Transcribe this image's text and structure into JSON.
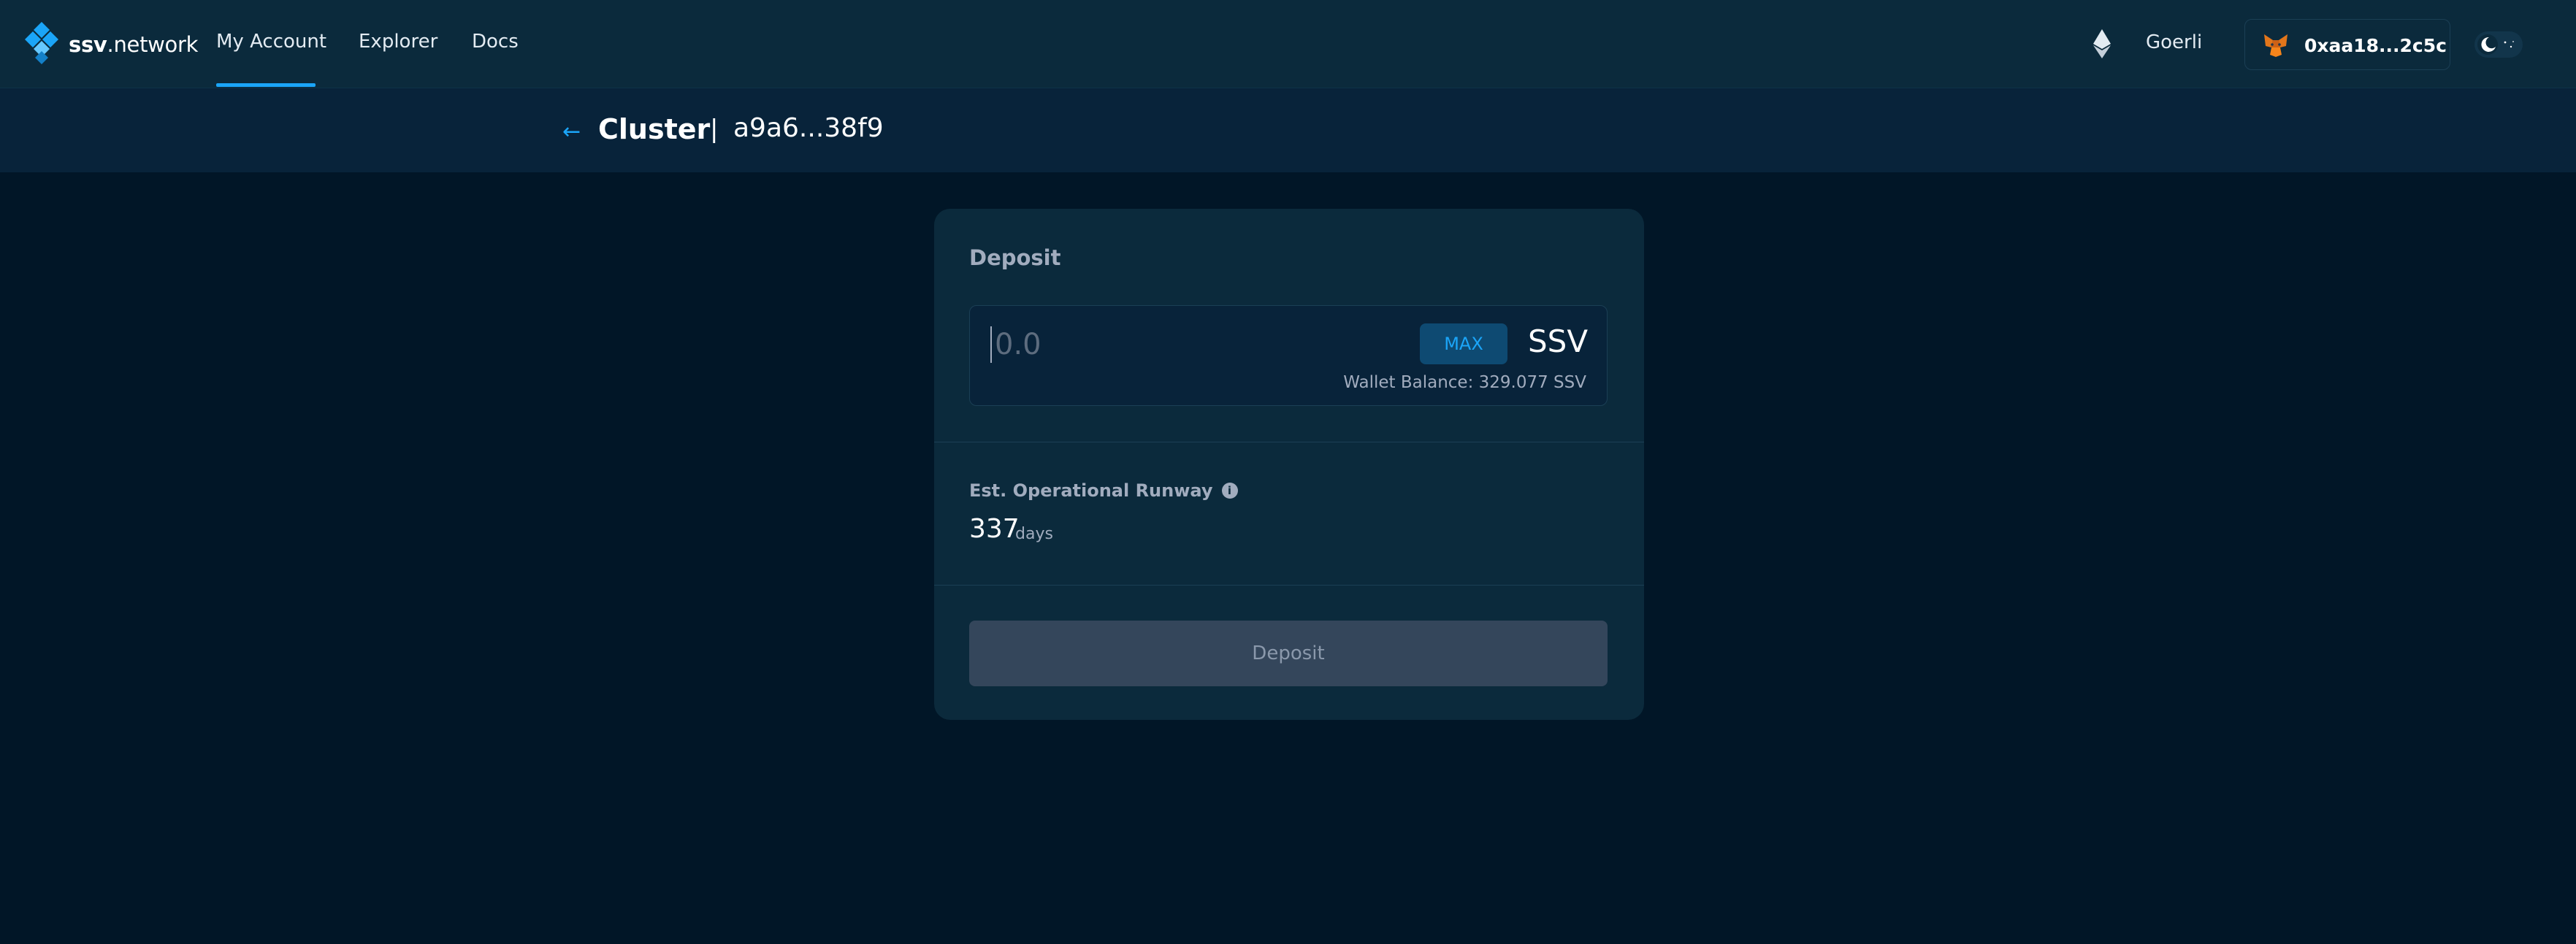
{
  "brand": {
    "name_bold": "ssv",
    "name_rest": ".network"
  },
  "nav": {
    "items": [
      {
        "label": "My Account",
        "active": true
      },
      {
        "label": "Explorer"
      },
      {
        "label": "Docs"
      }
    ]
  },
  "header": {
    "network": "Goerli",
    "wallet_address": "0xaa18...2c5c"
  },
  "page": {
    "title": "Cluster",
    "separator": "|",
    "cluster_id": "a9a6...38f9"
  },
  "deposit": {
    "heading": "Deposit",
    "input_placeholder": "0.0",
    "max_label": "MAX",
    "token": "SSV",
    "wallet_balance": "Wallet Balance: 329.077 SSV",
    "runway_label": "Est. Operational Runway",
    "runway_value": "337",
    "runway_unit": "days",
    "button_label": "Deposit"
  },
  "colors": {
    "background": "#011627",
    "topbar": "#0b2a3c",
    "accent": "#1ba5f8",
    "muted_text": "#a1acbe",
    "disabled_button": "#34465b"
  },
  "icons": {
    "back": "arrow-left-icon",
    "network": "ethereum-icon",
    "wallet": "metamask-fox-icon",
    "info": "info-icon",
    "theme": "moon-icon"
  }
}
